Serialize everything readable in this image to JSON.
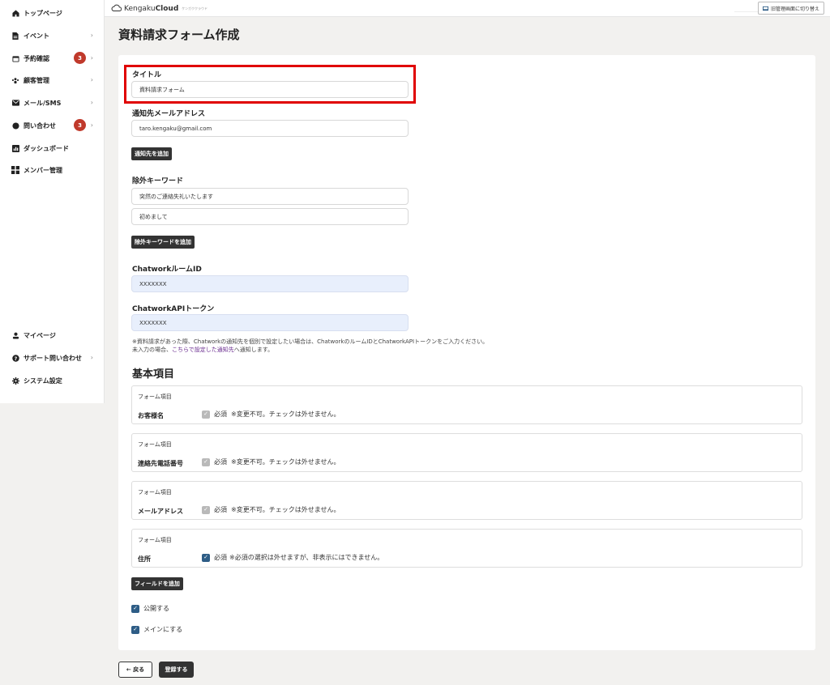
{
  "sidebar": {
    "items": [
      {
        "label": "トップページ",
        "icon": "home-icon",
        "chevron": false,
        "badge": null
      },
      {
        "label": "イベント",
        "icon": "document-icon",
        "chevron": true,
        "badge": null
      },
      {
        "label": "予約確認",
        "icon": "calendar-icon",
        "chevron": true,
        "badge": "3"
      },
      {
        "label": "顧客管理",
        "icon": "users-icon",
        "chevron": true,
        "badge": null
      },
      {
        "label": "メール/SMS",
        "icon": "mail-icon",
        "chevron": true,
        "badge": null
      },
      {
        "label": "問い合わせ",
        "icon": "chat-icon",
        "chevron": true,
        "badge": "3"
      },
      {
        "label": "ダッシュボード",
        "icon": "chart-icon",
        "chevron": false,
        "badge": null
      },
      {
        "label": "メンバー管理",
        "icon": "grid-icon",
        "chevron": false,
        "badge": null
      }
    ],
    "bottom_items": [
      {
        "label": "マイページ",
        "icon": "person-icon",
        "chevron": false
      },
      {
        "label": "サポート問い合わせ",
        "icon": "help-icon",
        "chevron": true
      },
      {
        "label": "システム設定",
        "icon": "gear-icon",
        "chevron": false
      }
    ],
    "chevron_glyph": "›"
  },
  "topbar": {
    "logo_text_light": "Kengaku",
    "logo_text_bold": "Cloud",
    "logo_sub": "ケンガククラウド",
    "switch_label": "旧管理画面に切り替え"
  },
  "page": {
    "title": "資料請求フォーム作成"
  },
  "form": {
    "title_label": "タイトル",
    "title_value": "資料請求フォーム",
    "notify_label": "通知先メールアドレス",
    "notify_value": "taro.kengaku@gmail.com",
    "add_notify_button": "通知先を追加",
    "exclude_label": "除外キーワード",
    "exclude_values": [
      "突然のご連絡失礼いたします",
      "初めまして"
    ],
    "add_exclude_button": "除外キーワードを追加",
    "chatwork_room_label": "ChatworkルームID",
    "chatwork_room_value": "XXXXXXX",
    "chatwork_token_label": "ChatworkAPIトークン",
    "chatwork_token_value": "XXXXXXX",
    "note_line1": "※資料請求があった際、Chatworkの通知先を個別で設定したい場合は、ChatworkのルームIDとChatworkAPIトークンをご入力ください。",
    "note_line2_pre": "未入力の場合、",
    "note_line2_link": "こちらで設定した通知先",
    "note_line2_post": "へ通知します。"
  },
  "basic": {
    "section_title": "基本項目",
    "fields": [
      {
        "type_label": "フォーム項目",
        "name": "お客様名",
        "required_label": "必須",
        "note": "※変更不可。チェックは外せません。",
        "locked": true
      },
      {
        "type_label": "フォーム項目",
        "name": "連絡先電話番号",
        "required_label": "必須",
        "note": "※変更不可。チェックは外せません。",
        "locked": true
      },
      {
        "type_label": "フォーム項目",
        "name": "メールアドレス",
        "required_label": "必須",
        "note": "※変更不可。チェックは外せません。",
        "locked": true
      },
      {
        "type_label": "フォーム項目",
        "name": "住所",
        "required_label": "必須",
        "note": "※必須の選択は外せますが、非表示にはできません。",
        "locked": false
      }
    ],
    "add_field_button": "フィールドを追加",
    "publish_label": "公開する",
    "main_label": "メインにする"
  },
  "footer": {
    "back_label": "← 戻る",
    "submit_label": "登録する"
  },
  "colors": {
    "highlight": "#e00000",
    "badge": "#c0392b",
    "checkbox_active": "#2e5d86",
    "checkbox_locked": "#b9b9b9",
    "dark_button": "#333333"
  }
}
